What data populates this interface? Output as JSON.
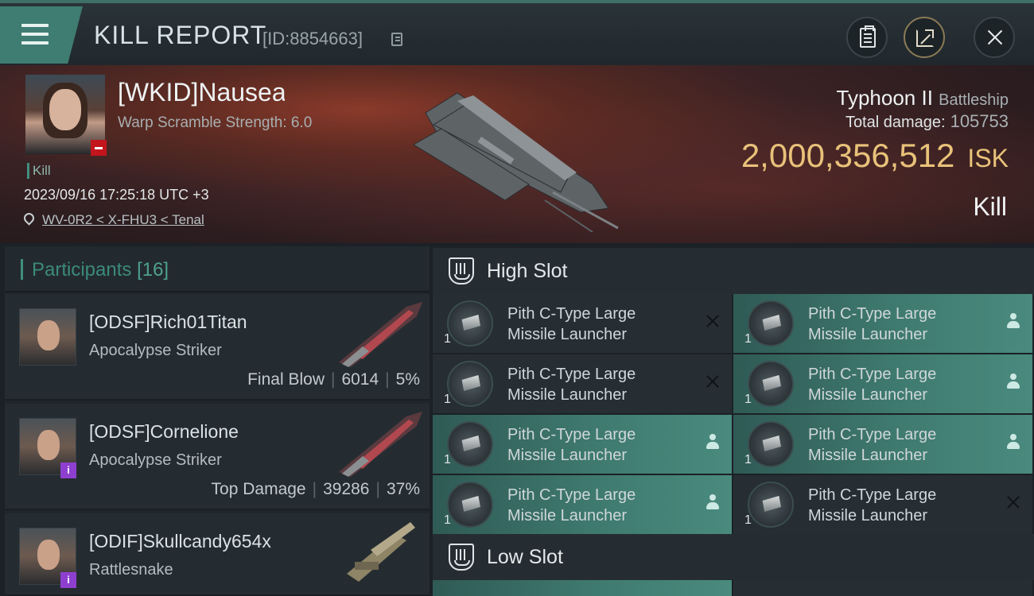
{
  "header": {
    "title": "KILL REPORT",
    "report_id": "[ID:8854663]"
  },
  "icons": {
    "menu": "menu-icon",
    "copy": "copy-icon",
    "clipboard": "clipboard-icon",
    "share": "share-icon",
    "close": "close-icon",
    "location": "location-pin-icon",
    "slot": "slot-shield-icon",
    "module_pilot": "person-icon",
    "module_destroyed": "x-icon"
  },
  "victim": {
    "name": "[WKID]Nausea",
    "warp_scramble": "Warp Scramble Strength: 6.0",
    "tag": "Kill",
    "datetime": "2023/09/16 17:25:18 UTC +3",
    "location": "WV-0R2 < X-FHU3 < Tenal",
    "ship_name": "Typhoon II",
    "ship_class": "Battleship",
    "total_damage_label": "Total damage:",
    "total_damage": "105753",
    "isk_value": "2,000,356,512",
    "isk_unit": "ISK",
    "result": "Kill"
  },
  "participants": {
    "label": "Participants",
    "count": "[16]",
    "items": [
      {
        "name": "[ODSF]Rich01Titan",
        "ship": "Apocalypse Striker",
        "role": "Final Blow",
        "damage": "6014",
        "percent": "5%"
      },
      {
        "name": "[ODSF]Cornelione",
        "ship": "Apocalypse Striker",
        "role": "Top Damage",
        "damage": "39286",
        "percent": "37%"
      },
      {
        "name": "[ODIF]Skullcandy654x",
        "ship": "Rattlesnake"
      }
    ]
  },
  "high_slot": {
    "label": "High Slot",
    "modules": [
      {
        "line1": "Pith C-Type Large",
        "line2": "Missile Launcher",
        "qty": "1",
        "state": "destroyed"
      },
      {
        "line1": "Pith C-Type Large",
        "line2": "Missile Launcher",
        "qty": "1",
        "state": "dropped"
      },
      {
        "line1": "Pith C-Type Large",
        "line2": "Missile Launcher",
        "qty": "1",
        "state": "destroyed"
      },
      {
        "line1": "Pith C-Type Large",
        "line2": "Missile Launcher",
        "qty": "1",
        "state": "dropped"
      },
      {
        "line1": "Pith C-Type Large",
        "line2": "Missile Launcher",
        "qty": "1",
        "state": "dropped"
      },
      {
        "line1": "Pith C-Type Large",
        "line2": "Missile Launcher",
        "qty": "1",
        "state": "dropped"
      },
      {
        "line1": "Pith C-Type Large",
        "line2": "Missile Launcher",
        "qty": "1",
        "state": "dropped"
      },
      {
        "line1": "Pith C-Type Large",
        "line2": "Missile Launcher",
        "qty": "1",
        "state": "destroyed"
      }
    ]
  },
  "low_slot": {
    "label": "Low Slot"
  },
  "colors": {
    "accent_teal": "#3f8f7f",
    "isk_gold": "#e9c27a",
    "badge_red": "#c2151d",
    "badge_purple": "#8e3fd0"
  }
}
